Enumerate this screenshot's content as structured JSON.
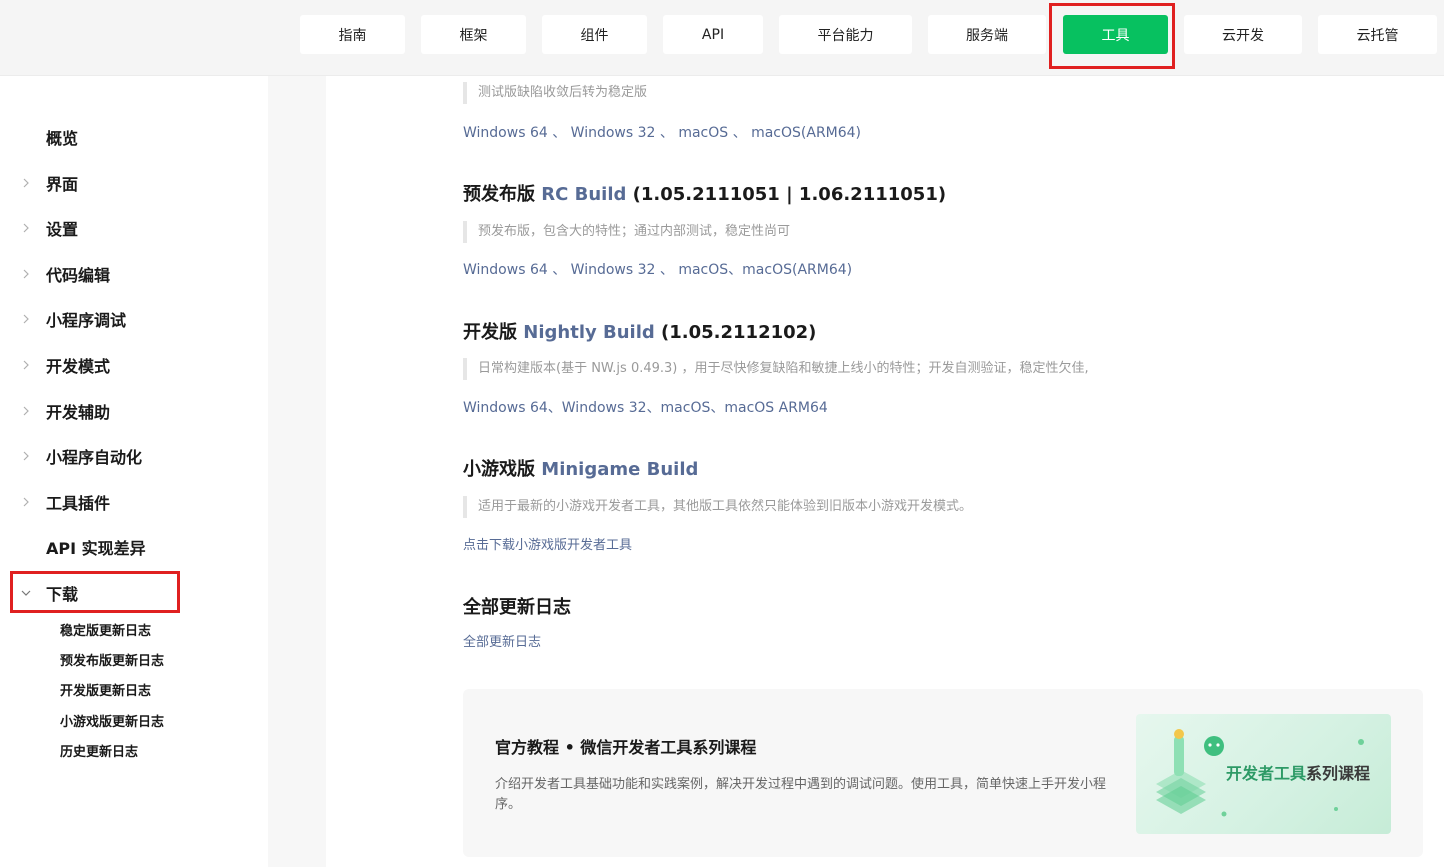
{
  "nav": {
    "items": [
      {
        "label": "指南"
      },
      {
        "label": "框架"
      },
      {
        "label": "组件"
      },
      {
        "label": "API"
      },
      {
        "label": "平台能力"
      },
      {
        "label": "服务端"
      },
      {
        "label": "工具"
      },
      {
        "label": "云开发"
      },
      {
        "label": "云托管"
      }
    ],
    "active": "工具",
    "accent_color": "#07c160"
  },
  "sidebar": {
    "items": [
      {
        "label": "概览",
        "expandable": false
      },
      {
        "label": "界面",
        "expandable": true
      },
      {
        "label": "设置",
        "expandable": true
      },
      {
        "label": "代码编辑",
        "expandable": true
      },
      {
        "label": "小程序调试",
        "expandable": true
      },
      {
        "label": "开发模式",
        "expandable": true
      },
      {
        "label": "开发辅助",
        "expandable": true
      },
      {
        "label": "小程序自动化",
        "expandable": true
      },
      {
        "label": "工具插件",
        "expandable": true
      },
      {
        "label": "API 实现差异",
        "expandable": false
      },
      {
        "label": "下载",
        "expandable": true,
        "expanded": true
      }
    ],
    "subitems": [
      {
        "label": "稳定版更新日志"
      },
      {
        "label": "预发布版更新日志"
      },
      {
        "label": "开发版更新日志"
      },
      {
        "label": "小游戏版更新日志"
      },
      {
        "label": "历史更新日志"
      }
    ]
  },
  "content": {
    "stable": {
      "note": "测试版缺陷收敛后转为稳定版",
      "links": [
        "Windows 64",
        "Windows 32",
        "macOS",
        "macOS(ARM64)"
      ]
    },
    "rc": {
      "prefix": "预发布版",
      "build": "RC Build",
      "version": "(1.05.2111051 | 1.06.2111051)",
      "note": "预发布版，包含大的特性；通过内部测试，稳定性尚可",
      "links": [
        "Windows 64",
        "Windows 32",
        "macOS",
        "macOS(ARM64)"
      ]
    },
    "nightly": {
      "prefix": "开发版",
      "build": "Nightly Build",
      "version": "(1.05.2112102)",
      "note": "日常构建版本(基于 NW.js 0.49.3) ，用于尽快修复缺陷和敏捷上线小的特性；开发自测验证，稳定性欠佳,",
      "links": [
        "Windows 64",
        "Windows 32",
        "macOS",
        "macOS ARM64"
      ]
    },
    "minigame": {
      "prefix": "小游戏版",
      "build": "Minigame Build",
      "note": "适用于最新的小游戏开发者工具，其他版工具依然只能体验到旧版本小游戏开发模式。",
      "link": "点击下载小游戏版开发者工具"
    },
    "changelog": {
      "title": "全部更新日志",
      "link": "全部更新日志"
    },
    "course": {
      "title": "官方教程 • 微信开发者工具系列课程",
      "desc": "介绍开发者工具基础功能和实践案例，解决开发过程中遇到的调试问题。使用工具，简单快速上手开发小程序。",
      "image_text_green": "开发者",
      "image_text_green2": "工具",
      "image_text_dark": "系列课程"
    }
  }
}
